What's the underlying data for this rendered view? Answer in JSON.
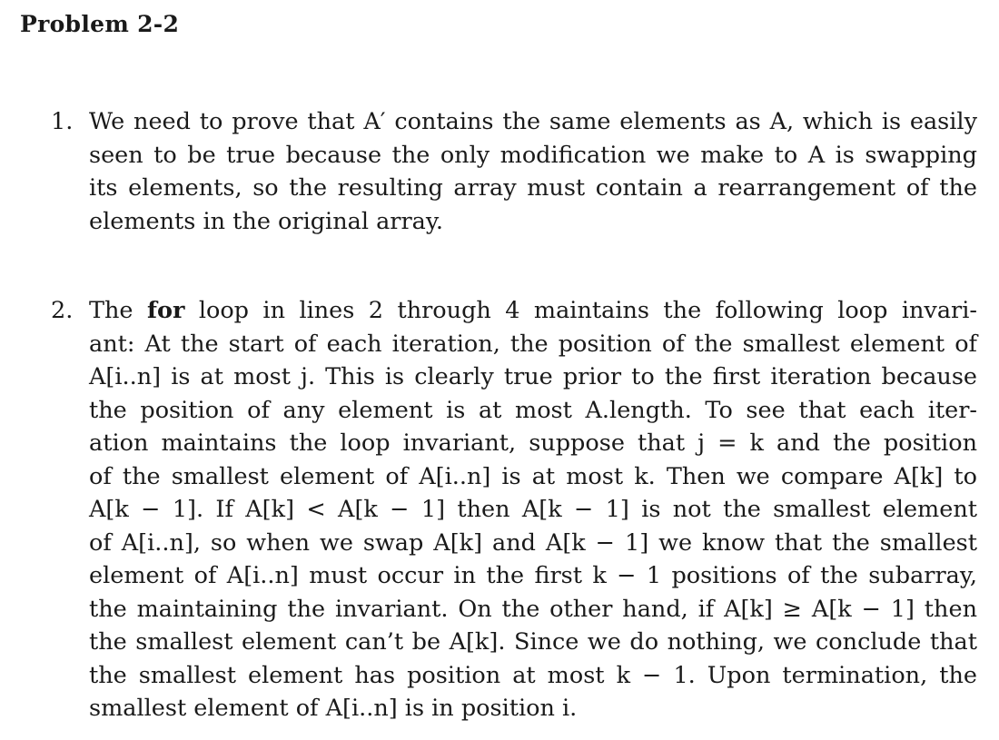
{
  "title": "Problem 2-2",
  "item1": {
    "num": "1.",
    "lines": [
      "We need to prove that A′ contains the same elements as A, which is easily",
      "seen to be true because the only modification we make to A is swapping",
      "its elements, so the resulting array must contain a rearrangement of the",
      "elements in the original array."
    ]
  },
  "item2": {
    "num": "2.",
    "l1_a": "The ",
    "l1_bold": "for",
    "l1_b": " loop in lines 2 through 4 maintains the following loop invari-",
    "lines": [
      "ant: At the start of each iteration, the position of the smallest element of",
      "A[i..n] is at most j. This is clearly true prior to the first iteration because",
      "the position of any element is at most A.length. To see that each iter-",
      "ation maintains the loop invariant, suppose that j = k and the position",
      "of the smallest element of A[i..n] is at most k. Then we compare A[k] to",
      "A[k − 1]. If A[k] < A[k − 1] then A[k − 1] is not the smallest element",
      "of A[i..n], so when we swap A[k] and A[k − 1] we know that the smallest",
      "element of A[i..n] must occur in the first k − 1 positions of the subarray,",
      "the maintaining the invariant. On the other hand, if A[k] ≥ A[k − 1] then",
      "the smallest element can’t be A[k]. Since we do nothing, we conclude that",
      "the smallest element has position at most k − 1. Upon termination, the",
      "smallest element of A[i..n] is in position i."
    ]
  }
}
